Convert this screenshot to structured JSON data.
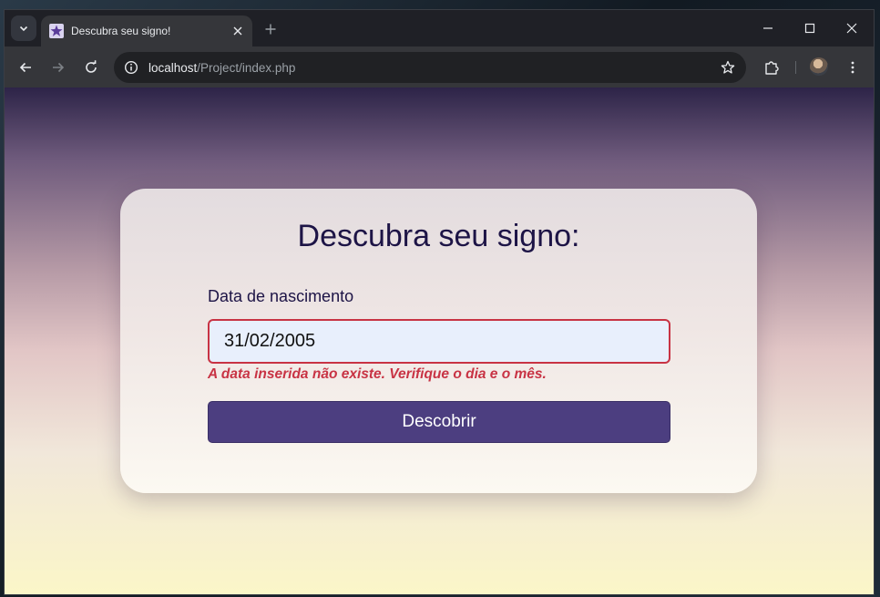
{
  "browser": {
    "tab": {
      "title": "Descubra seu signo!",
      "favicon": "star-icon"
    },
    "address_bar": {
      "host": "localhost",
      "path": "/Project/index.php"
    },
    "icons": {
      "tab_search": "chevron-down-icon",
      "new_tab": "plus-icon",
      "minimize": "minimize-icon",
      "maximize": "maximize-icon",
      "close": "close-icon",
      "back": "back-arrow-icon",
      "forward": "forward-arrow-icon",
      "reload": "reload-icon",
      "site_info": "info-icon",
      "bookmark": "star-outline-icon",
      "extensions": "puzzle-icon",
      "menu": "kebab-menu-icon"
    }
  },
  "page": {
    "title": "Descubra seu signo:",
    "birthdate_label": "Data de nascimento",
    "birthdate_value": "31/02/2005",
    "error_message": "A data inserida não existe. Verifique o dia e o mês.",
    "submit_label": "Descobrir"
  },
  "colors": {
    "error": "#c83344",
    "button": "#4c3e80",
    "title_text": "#1d1446"
  }
}
